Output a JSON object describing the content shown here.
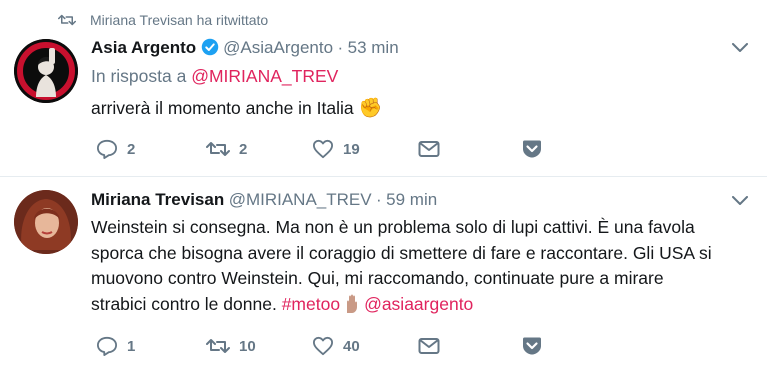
{
  "retweet_header": {
    "text": "Miriana Trevisan ha ritwittato"
  },
  "tweet1": {
    "display_name": "Asia Argento",
    "handle": "@AsiaArgento",
    "separator": "·",
    "time": "53 min",
    "reply_prefix": "In risposta a",
    "reply_handle": "@MIRIANA_TREV",
    "text": "arriverà il momento anche in Italia",
    "emoji": "✊",
    "replies": "2",
    "retweets": "2",
    "likes": "19"
  },
  "tweet2": {
    "display_name": "Miriana Trevisan",
    "handle": "@MIRIANA_TREV",
    "separator": "·",
    "time": "59 min",
    "line1": "Weinstein si consegna. Ma non è un problema solo di lupi cattivi. È una favola",
    "line2": "sporca che bisogna avere il coraggio di smettere di fare e raccontare. Gli USA si",
    "line3": "muovono contro Weinstein. Qui, mi raccomando, continuate pure a mirare",
    "line4_text": "strabici contro le donne.",
    "hashtag": "#metoo",
    "mention": "@asiaargento",
    "replies": "1",
    "retweets": "10",
    "likes": "40"
  },
  "colors": {
    "link": "#e0245e",
    "muted": "#657786",
    "verified": "#1da1f2",
    "divider": "#e6ecf0"
  }
}
